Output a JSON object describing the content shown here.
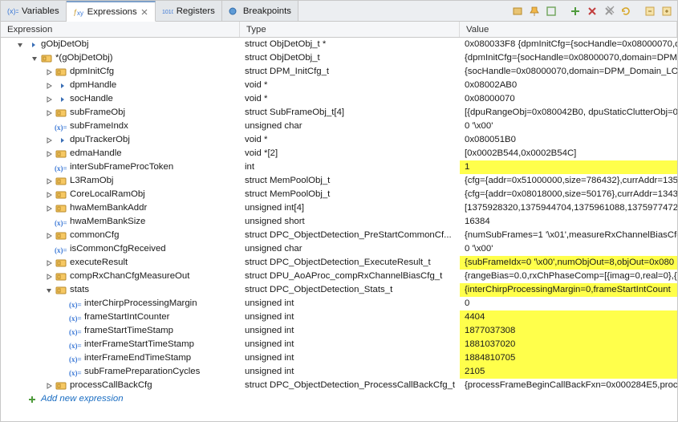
{
  "tabs": {
    "variables": "Variables",
    "expressions": "Expressions",
    "registers": "Registers",
    "breakpoints": "Breakpoints"
  },
  "headers": {
    "expression": "Expression",
    "type": "Type",
    "value": "Value"
  },
  "rows": [
    {
      "d": 0,
      "tw": "open",
      "ic": "ptr",
      "name": "gObjDetObj",
      "type": "struct ObjDetObj_t *",
      "value": "0x080033F8 {dpmInitCfg={socHandle=0x08000070,d",
      "hl": false
    },
    {
      "d": 1,
      "tw": "open",
      "ic": "struct",
      "name": "*(gObjDetObj)",
      "type": "struct ObjDetObj_t",
      "value": "{dpmInitCfg={socHandle=0x08000070,domain=DPM",
      "hl": false
    },
    {
      "d": 2,
      "tw": "close",
      "ic": "struct",
      "name": "dpmInitCfg",
      "type": "struct DPM_InitCfg_t",
      "value": "{socHandle=0x08000070,domain=DPM_Domain_LO",
      "hl": false
    },
    {
      "d": 2,
      "tw": "close",
      "ic": "ptr",
      "name": "dpmHandle",
      "type": "void *",
      "value": "0x08002AB0",
      "hl": false
    },
    {
      "d": 2,
      "tw": "close",
      "ic": "ptr",
      "name": "socHandle",
      "type": "void *",
      "value": "0x08000070",
      "hl": false
    },
    {
      "d": 2,
      "tw": "close",
      "ic": "struct",
      "name": "subFrameObj",
      "type": "struct SubFrameObj_t[4]",
      "value": "[{dpuRangeObj=0x080042B0, dpuStaticClutterObj=0",
      "hl": false
    },
    {
      "d": 2,
      "tw": "none",
      "ic": "var",
      "name": "subFrameIndx",
      "type": "unsigned char",
      "value": "0 '\\x00'",
      "hl": false
    },
    {
      "d": 2,
      "tw": "close",
      "ic": "ptr",
      "name": "dpuTrackerObj",
      "type": "void *",
      "value": "0x080051B0",
      "hl": false
    },
    {
      "d": 2,
      "tw": "close",
      "ic": "struct",
      "name": "edmaHandle",
      "type": "void *[2]",
      "value": "[0x0002B544,0x0002B54C]",
      "hl": false
    },
    {
      "d": 2,
      "tw": "none",
      "ic": "var",
      "name": "interSubFrameProcToken",
      "type": "int",
      "value": "1",
      "hl": true
    },
    {
      "d": 2,
      "tw": "close",
      "ic": "struct",
      "name": "L3RamObj",
      "type": "struct MemPoolObj_t",
      "value": "{cfg={addr=0x51000000,size=786432},currAddr=135",
      "hl": false
    },
    {
      "d": 2,
      "tw": "close",
      "ic": "struct",
      "name": "CoreLocalRamObj",
      "type": "struct MemPoolObj_t",
      "value": "{cfg={addr=0x08018000,size=50176},currAddr=1343",
      "hl": false
    },
    {
      "d": 2,
      "tw": "close",
      "ic": "struct",
      "name": "hwaMemBankAddr",
      "type": "unsigned int[4]",
      "value": "[1375928320,1375944704,1375961088,1375977472]",
      "hl": false
    },
    {
      "d": 2,
      "tw": "none",
      "ic": "var",
      "name": "hwaMemBankSize",
      "type": "unsigned short",
      "value": "16384",
      "hl": false
    },
    {
      "d": 2,
      "tw": "close",
      "ic": "struct",
      "name": "commonCfg",
      "type": "struct DPC_ObjectDetection_PreStartCommonCf...",
      "value": "{numSubFrames=1 '\\x01',measureRxChannelBiasCfg",
      "hl": false
    },
    {
      "d": 2,
      "tw": "none",
      "ic": "var",
      "name": "isCommonCfgReceived",
      "type": "unsigned char",
      "value": "0 '\\x00'",
      "hl": false
    },
    {
      "d": 2,
      "tw": "close",
      "ic": "struct",
      "name": "executeResult",
      "type": "struct DPC_ObjectDetection_ExecuteResult_t",
      "value": "{subFrameIdx=0 '\\x00',numObjOut=8,objOut=0x080",
      "hl": true
    },
    {
      "d": 2,
      "tw": "close",
      "ic": "struct",
      "name": "compRxChanCfgMeasureOut",
      "type": "struct DPU_AoAProc_compRxChannelBiasCfg_t",
      "value": "{rangeBias=0.0,rxChPhaseComp=[{imag=0,real=0},{",
      "hl": false
    },
    {
      "d": 2,
      "tw": "open",
      "ic": "struct",
      "name": "stats",
      "type": "struct DPC_ObjectDetection_Stats_t",
      "value": "{interChirpProcessingMargin=0,frameStartIntCount",
      "hl": true
    },
    {
      "d": 3,
      "tw": "none",
      "ic": "var",
      "name": "interChirpProcessingMargin",
      "type": "unsigned int",
      "value": "0",
      "hl": false
    },
    {
      "d": 3,
      "tw": "none",
      "ic": "var",
      "name": "frameStartIntCounter",
      "type": "unsigned int",
      "value": "4404",
      "hl": true
    },
    {
      "d": 3,
      "tw": "none",
      "ic": "var",
      "name": "frameStartTimeStamp",
      "type": "unsigned int",
      "value": "1877037308",
      "hl": true
    },
    {
      "d": 3,
      "tw": "none",
      "ic": "var",
      "name": "interFrameStartTimeStamp",
      "type": "unsigned int",
      "value": "1881037020",
      "hl": true
    },
    {
      "d": 3,
      "tw": "none",
      "ic": "var",
      "name": "interFrameEndTimeStamp",
      "type": "unsigned int",
      "value": "1884810705",
      "hl": true
    },
    {
      "d": 3,
      "tw": "none",
      "ic": "var",
      "name": "subFramePreparationCycles",
      "type": "unsigned int",
      "value": "2105",
      "hl": true
    },
    {
      "d": 2,
      "tw": "close",
      "ic": "struct",
      "name": "processCallBackCfg",
      "type": "struct DPC_ObjectDetection_ProcessCallBackCfg_t",
      "value": "{processFrameBeginCallBackFxn=0x000284E5,proce",
      "hl": false
    }
  ],
  "addNew": "Add new expression"
}
